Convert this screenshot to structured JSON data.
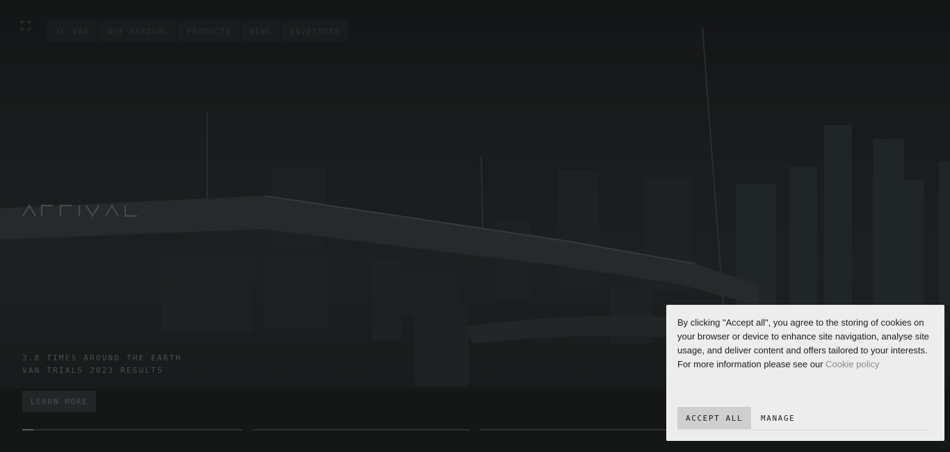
{
  "nav": {
    "menu_icon": "expand-icon",
    "items": [
      "XL VAN",
      "WHY ARRIVAL",
      "PRODUCTS",
      "NEWS",
      "INVESTORS"
    ]
  },
  "hero": {
    "logo_text": "ARRIVAL",
    "headline_line1": "3.8 TIMES AROUND THE EARTH.",
    "headline_line2": "VAN TRIALS 2023 RESULTS",
    "cta_label": "LEARN MORE",
    "slides_progress": [
      0.05,
      0,
      0
    ]
  },
  "cookie_banner": {
    "text": "By clicking \"Accept all\", you agree to the storing of cookies on your browser or device to enhance site navigation, analyse site usage, and deliver content and offers tailored to your interests. For more information please see our ",
    "link_label": "Cookie policy",
    "accept_label": "ACCEPT ALL",
    "manage_label": "MANAGE"
  }
}
